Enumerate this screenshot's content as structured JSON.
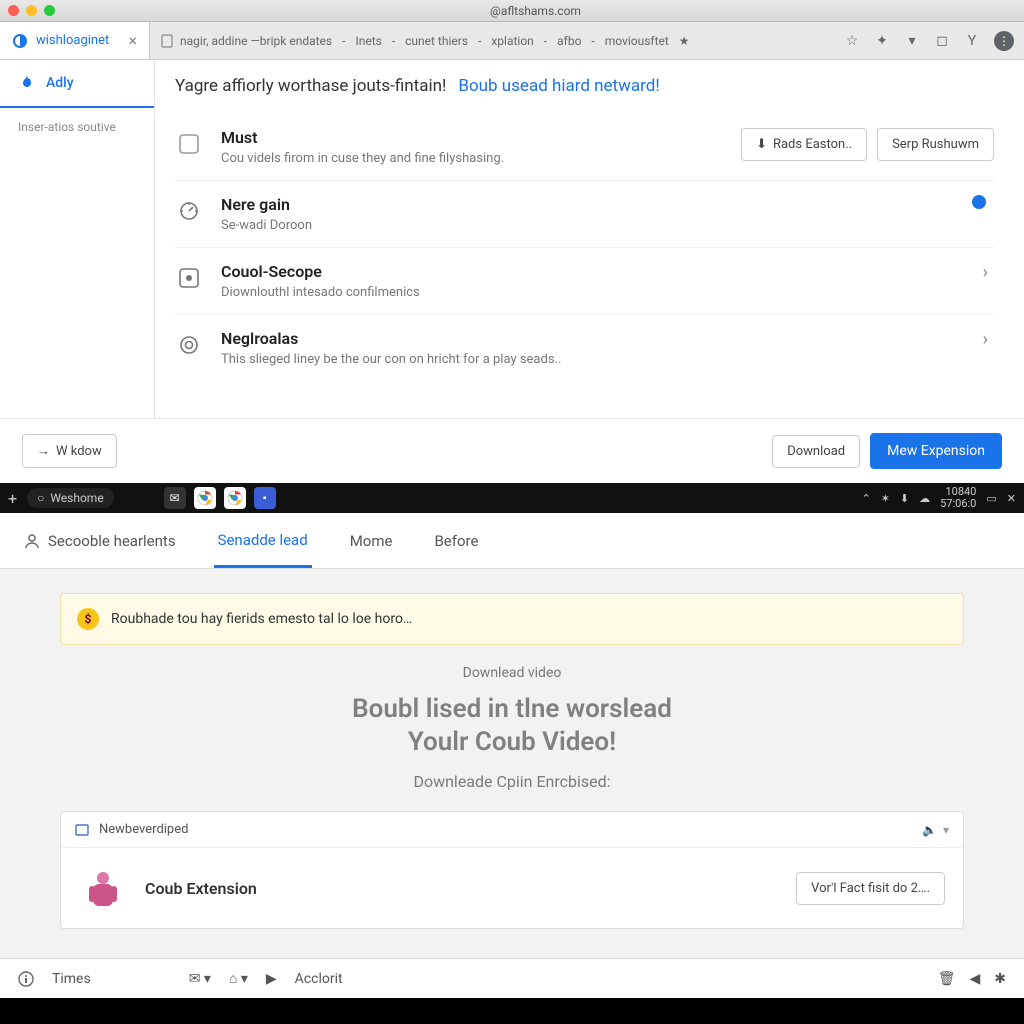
{
  "titlebar": {
    "title": "@afltshams.com"
  },
  "tab": {
    "title": "wishloaginet"
  },
  "addressbar": {
    "items": [
      "nagir, addine —bripk endates",
      "Inets",
      "cunet thiers",
      "xplation",
      "afbo",
      "moviousftet"
    ]
  },
  "sidebar": {
    "active": {
      "label": "Adly"
    },
    "sub": "Inser-atios soutive"
  },
  "header": {
    "dark": "Yagre affiorly worthase jouts-fintain!",
    "blue": "Boub usead hiard netward!"
  },
  "rows": [
    {
      "title": "Must",
      "desc": "Cou videls firom in cuse they and fine filyshasing.",
      "btn1": "Rads Easton..",
      "btn2": "Serp Rushuwm"
    },
    {
      "title": "Nere gain",
      "desc": "Se-wadi Doroon"
    },
    {
      "title": "Couol-Secope",
      "desc": "Diownlouthl intesado confilmenics"
    },
    {
      "title": "Neglroalas",
      "desc": "This slieged liney be the our con on hricht for a play seads.."
    }
  ],
  "footer": {
    "wkdow": "W kdow",
    "download": "Download",
    "expand": "Mew Expension"
  },
  "darkbar": {
    "search": "Weshome",
    "clock1": "10840",
    "clock2": "57:06:0"
  },
  "tabs2": [
    {
      "label": "Secooble hearlents",
      "active": false
    },
    {
      "label": "Senadde lead",
      "active": true
    },
    {
      "label": "Mome",
      "active": false
    },
    {
      "label": "Before",
      "active": false
    }
  ],
  "panel": {
    "alert": "Roubhade tou hay fierids emesto tal lo loe horo…",
    "download_text": "Downlead video",
    "big1": "Boubl lised in tlne worslead",
    "big2": "Youlr Coub Video!",
    "sub": "Downleade Cpiin Enrcbised:",
    "card_head": "Newbeverdiped",
    "card_title": "Coub Extension",
    "card_btn": "Vor'l Fact fisit do 2…."
  },
  "statusbar": {
    "left": "Times",
    "acc": "Acclorit"
  }
}
